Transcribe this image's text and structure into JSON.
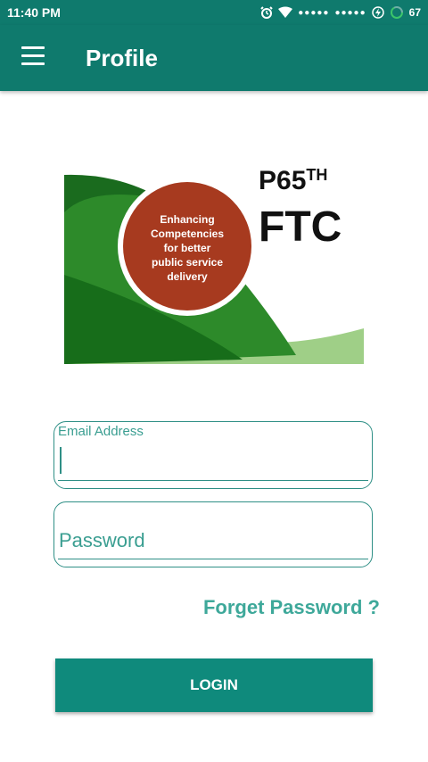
{
  "status_bar": {
    "time": "11:40 PM",
    "signal_dots_1": "●●●●●",
    "signal_dots_2": "●●●●●",
    "battery": "67",
    "icons": [
      "alarm-icon",
      "wifi-icon",
      "signal-icon",
      "charging-icon",
      "battery-ring-icon"
    ]
  },
  "app_bar": {
    "title": "Profile",
    "menu_icon": "hamburger-menu-icon"
  },
  "logo": {
    "circle_text": [
      "Enhancing",
      "Competencies",
      "for better",
      "public service",
      "delivery"
    ],
    "header_line1": "P65",
    "header_superscript": "TH",
    "header_line2": "FTC"
  },
  "form": {
    "email_label": "Email Address",
    "password_placeholder": "Password",
    "forget_password": "Forget Password ?",
    "login_label": "LOGIN"
  },
  "colors": {
    "primary": "#0f7a6d",
    "accent": "#3ea89a",
    "button": "#0f8a7c"
  }
}
